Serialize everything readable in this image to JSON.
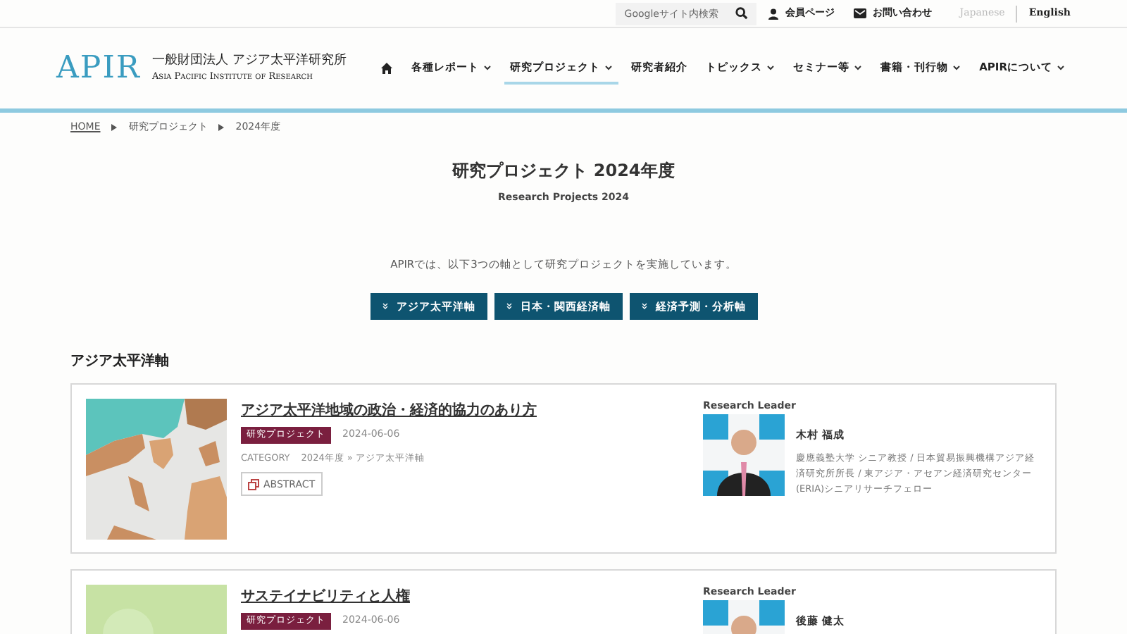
{
  "topbar": {
    "search": {
      "placeholder": "Googleサイト内検索"
    },
    "links": [
      {
        "label": "会員ページ",
        "kind": "person"
      },
      {
        "label": "お問い合わせ",
        "kind": "mail"
      }
    ],
    "languages": [
      {
        "label": "Japanese",
        "selected": true
      },
      {
        "label": "English",
        "selected": false
      }
    ]
  },
  "header": {
    "logo": "APIR",
    "org_ja": "一般財団法人 アジア太平洋研究所",
    "org_en": "Asia Pacific Institute of Research",
    "nav": [
      {
        "label": "各種レポート",
        "dropdown": true,
        "selected": false
      },
      {
        "label": "研究プロジェクト",
        "dropdown": true,
        "selected": true
      },
      {
        "label": "研究者紹介",
        "dropdown": false,
        "selected": false
      },
      {
        "label": "トピックス",
        "dropdown": true,
        "selected": false
      },
      {
        "label": "セミナー等",
        "dropdown": true,
        "selected": false
      },
      {
        "label": "書籍・刊行物",
        "dropdown": true,
        "selected": false
      },
      {
        "label": "APIRについて",
        "dropdown": true,
        "selected": false
      }
    ]
  },
  "breadcrumb": [
    "HOME",
    "研究プロジェクト",
    "2024年度"
  ],
  "title": "研究プロジェクト 2024年度",
  "subtitle": "Research Projects 2024",
  "intro": "APIRでは、以下3つの軸として研究プロジェクトを実施しています。",
  "axis_buttons": [
    "アジア太平洋軸",
    "日本・関西経済軸",
    "経済予測・分析軸"
  ],
  "section_heading": "アジア太平洋軸",
  "projects": [
    {
      "title": "アジア太平洋地域の政治・経済的協力のあり方",
      "tag": "研究プロジェクト",
      "date": "2024-06-06",
      "category_label": "CATEGORY",
      "category": "2024年度 » アジア太平洋軸",
      "abstract": "ABSTRACT",
      "leader_label": "Research Leader",
      "leader_name": "木村 福成",
      "leader_affiliation": "慶應義塾大学 シニア教授 / 日本貿易振興機構アジア経済研究所所長 / 東アジア・アセアン経済研究センター(ERIA)シニアリサーチフェロー"
    },
    {
      "title": "サステイナビリティと人権",
      "tag": "研究プロジェクト",
      "date": "2024-06-06",
      "leader_label": "Research Leader",
      "leader_name": "後藤 健太"
    }
  ]
}
